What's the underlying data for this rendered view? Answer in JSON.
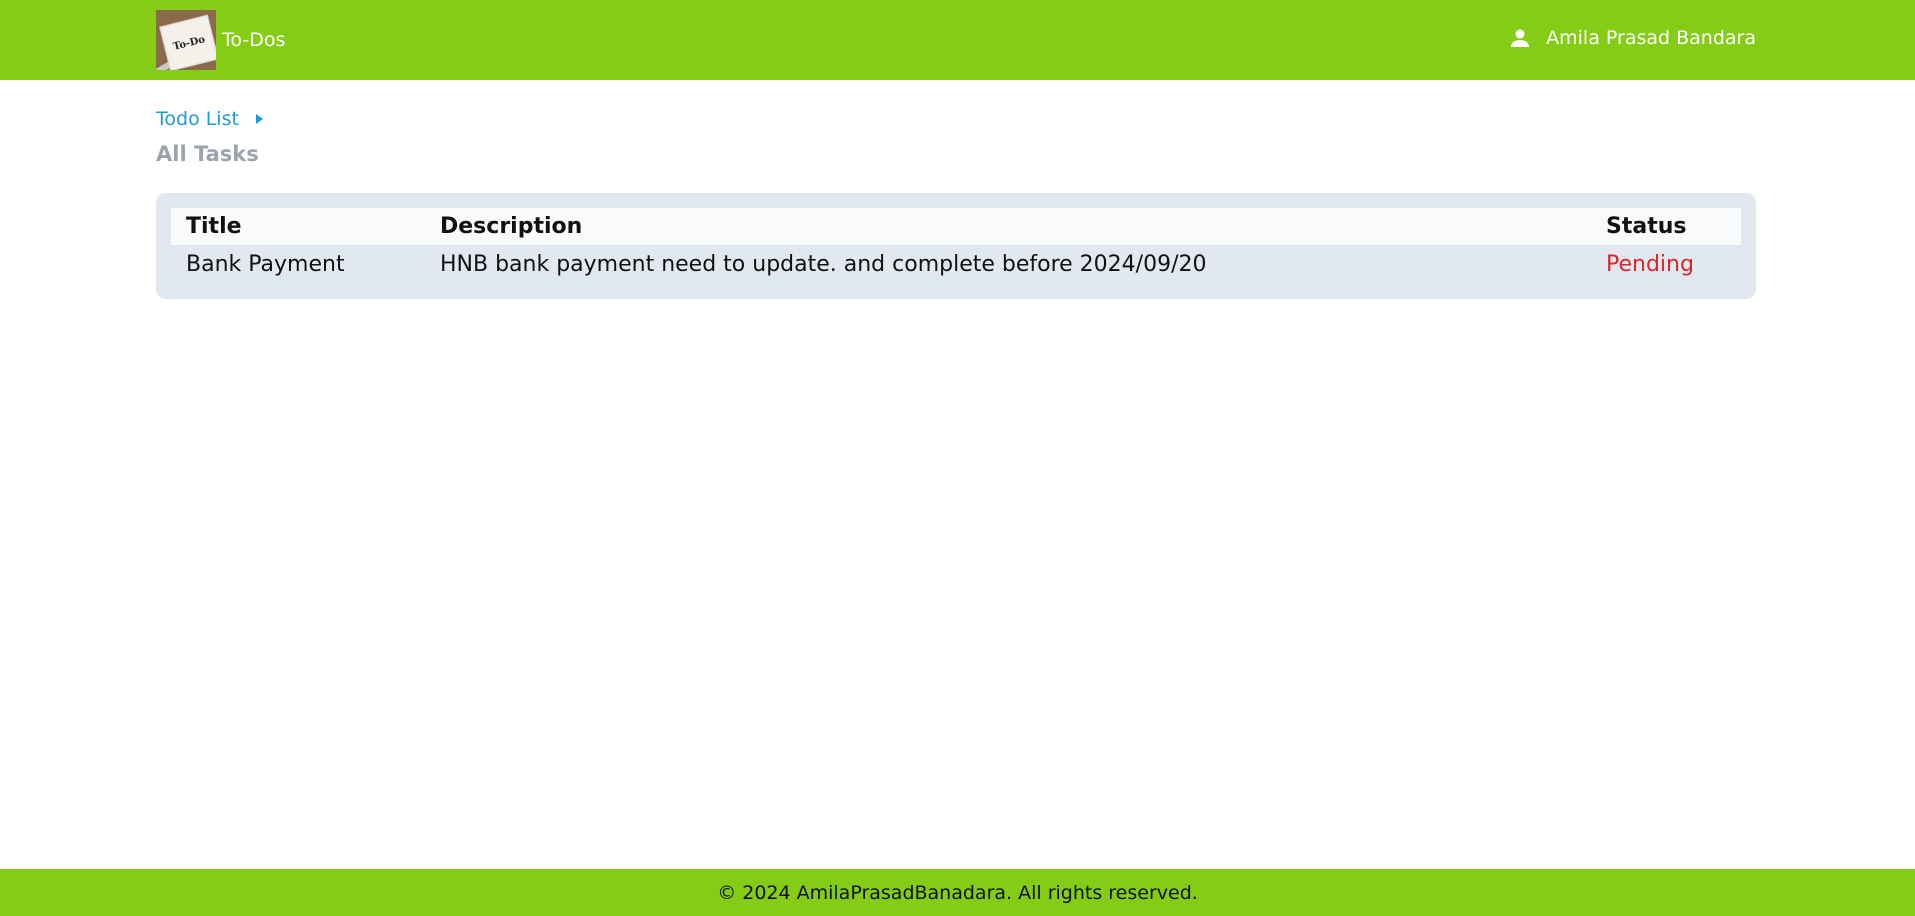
{
  "header": {
    "app_name": "To-Dos",
    "logo_text": "To-Do",
    "user_name": "Amila Prasad Bandara",
    "user_icon": "person-icon"
  },
  "breadcrumb": {
    "label": "Todo List",
    "icon": "caret-right-icon"
  },
  "page_title": "All Tasks",
  "table": {
    "headers": [
      "Title",
      "Description",
      "Status"
    ],
    "rows": [
      {
        "title": "Bank Payment",
        "description": "HNB bank payment need to update. and complete before 2024/09/20",
        "status": "Pending"
      }
    ]
  },
  "footer": {
    "text": "© 2024 AmilaPrasadBanadara. All rights reserved."
  },
  "colors": {
    "brand": "#84cc16",
    "link": "#1f9bd7",
    "status_pending": "#dc2626",
    "table_bg": "#e2e8f0"
  }
}
